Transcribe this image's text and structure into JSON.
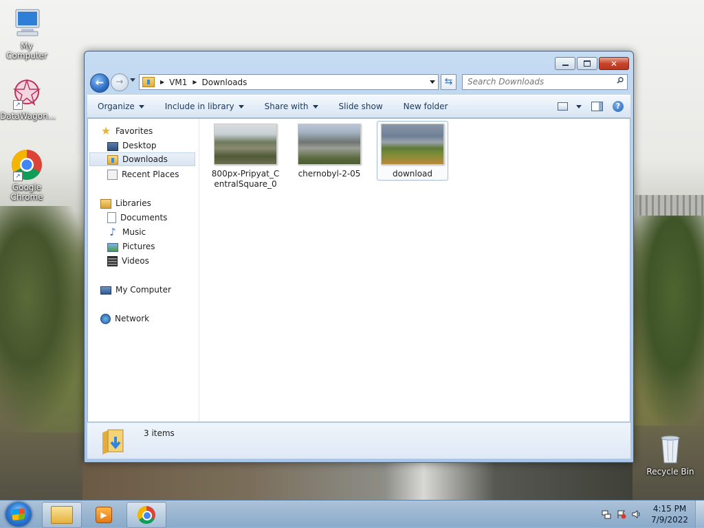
{
  "desktop": {
    "icons": [
      {
        "label": "My Computer"
      },
      {
        "label": "DataWagon..."
      },
      {
        "label": "Google Chrome"
      },
      {
        "label": "Recycle Bin"
      }
    ]
  },
  "window": {
    "breadcrumb": [
      "VM1",
      "Downloads"
    ],
    "search_placeholder": "Search Downloads",
    "toolbar": {
      "organize": "Organize",
      "include_in_library": "Include in library",
      "share_with": "Share with",
      "slide_show": "Slide show",
      "new_folder": "New folder"
    },
    "nav": {
      "favorites": "Favorites",
      "desktop": "Desktop",
      "downloads": "Downloads",
      "recent_places": "Recent Places",
      "libraries": "Libraries",
      "documents": "Documents",
      "music": "Music",
      "pictures": "Pictures",
      "videos": "Videos",
      "my_computer": "My Computer",
      "network": "Network"
    },
    "files": [
      {
        "name": "800px-Pripyat_CentralSquare_0"
      },
      {
        "name": "chernobyl-2-05"
      },
      {
        "name": "download"
      }
    ],
    "status": {
      "item_count": "3 items"
    }
  },
  "taskbar": {
    "time": "4:15 PM",
    "date": "7/9/2022"
  },
  "colors": {
    "accent": "#2d6fc7",
    "close_button": "#c8452b"
  }
}
